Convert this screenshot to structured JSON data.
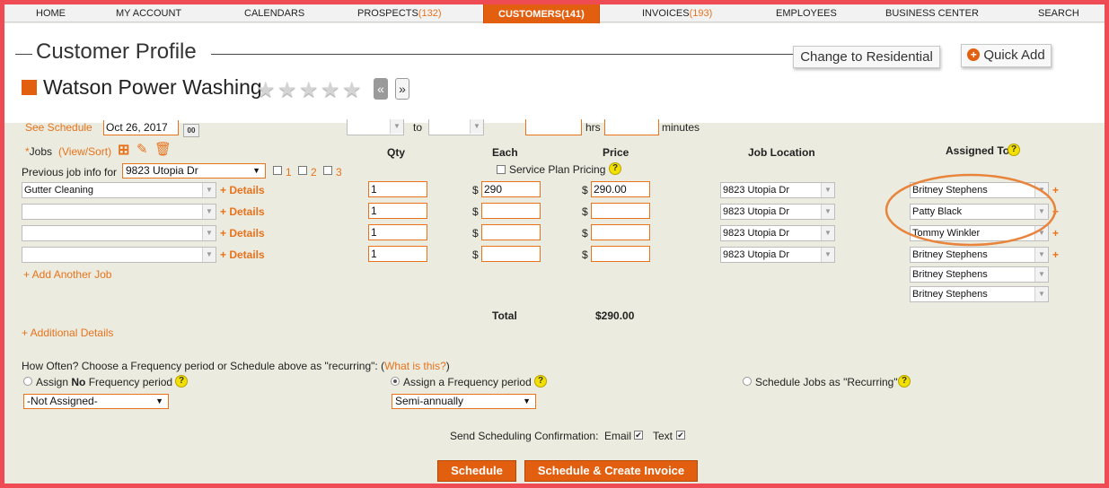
{
  "nav": {
    "items": [
      {
        "label": "HOME",
        "count": ""
      },
      {
        "label": "MY ACCOUNT",
        "count": ""
      },
      {
        "label": "CALENDARS",
        "count": ""
      },
      {
        "label": "PROSPECTS",
        "count": "(132)"
      },
      {
        "label": "CUSTOMERS",
        "count": "(141)"
      },
      {
        "label": "INVOICES",
        "count": "(193)"
      },
      {
        "label": "EMPLOYEES",
        "count": ""
      },
      {
        "label": "BUSINESS CENTER",
        "count": ""
      },
      {
        "label": "SEARCH",
        "count": ""
      }
    ]
  },
  "header": {
    "title": "Customer Profile",
    "residential_button": "Change to Residential",
    "quick_add_button": "Quick Add",
    "company_name": "Watson Power Washing",
    "rating": 0,
    "max_rating": 5,
    "pager_prev": "«",
    "pager_next": "»"
  },
  "schedule": {
    "see_schedule": "See Schedule",
    "date": "Oct 26, 2017",
    "calendar_badge": "00",
    "to_label": "to",
    "hrs_label": "hrs",
    "minutes_label": "minutes"
  },
  "jobs": {
    "label": "Jobs",
    "required_mark": "*",
    "view_sort": "(View/Sort)",
    "prev_info_label": "Previous job info for",
    "prev_info_value": "9823 Utopia Dr",
    "checkbox_labels": [
      "1",
      "2",
      "3"
    ],
    "details_link": "+ Details",
    "add_another": "+ Add Another Job",
    "additional_details": "+ Additional Details"
  },
  "columns": {
    "qty": "Qty",
    "each": "Each",
    "price": "Price",
    "job_location": "Job Location",
    "assigned_to": "Assigned To",
    "service_plan": "Service Plan Pricing",
    "currency": "$"
  },
  "job_rows": [
    {
      "service": "Gutter Cleaning",
      "qty": "1",
      "each": "290",
      "price": "290.00",
      "location": "9823 Utopia Dr",
      "assigned": "Britney Stephens"
    },
    {
      "service": "",
      "qty": "1",
      "each": "",
      "price": "",
      "location": "9823 Utopia Dr",
      "assigned": "Patty Black"
    },
    {
      "service": "",
      "qty": "1",
      "each": "",
      "price": "",
      "location": "9823 Utopia Dr",
      "assigned": "Tommy Winkler"
    },
    {
      "service": "",
      "qty": "1",
      "each": "",
      "price": "",
      "location": "9823 Utopia Dr",
      "assigned": "Britney Stephens"
    }
  ],
  "extra_assignees": [
    "Britney Stephens",
    "Britney Stephens"
  ],
  "total": {
    "label": "Total",
    "value": "$290.00"
  },
  "frequency": {
    "question": "How Often? Choose a Frequency period or Schedule above as \"recurring\": (",
    "what_is_this": "What is this?",
    "close_paren": ")",
    "opt_none_pre": "Assign ",
    "opt_none_bold": "No",
    "opt_none_post": " Frequency period",
    "opt_period": "Assign a Frequency period",
    "opt_recurring": "Schedule Jobs as \"Recurring\"",
    "none_select": "-Not Assigned-",
    "period_select": "Semi-annually",
    "selected_option": "period"
  },
  "confirmation": {
    "label": "Send Scheduling Confirmation:",
    "email": "Email",
    "text": "Text",
    "email_checked": true,
    "text_checked": true
  },
  "actions": {
    "schedule": "Schedule",
    "schedule_invoice": "Schedule & Create Invoice"
  },
  "colors": {
    "accent": "#e35f10",
    "link": "#e8731c",
    "annotation": "#e8843c",
    "border_frame": "#ef4b55"
  }
}
